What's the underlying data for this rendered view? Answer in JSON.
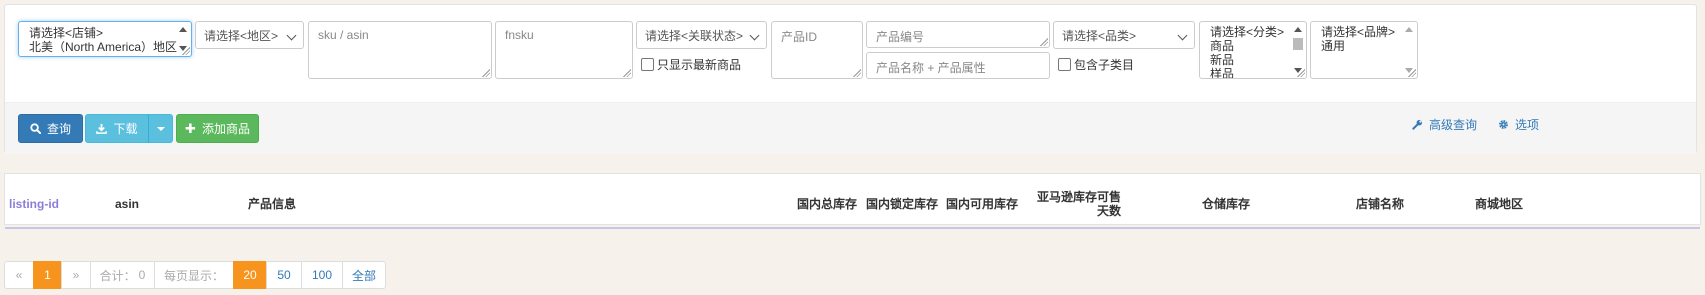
{
  "filters": {
    "shop_select": {
      "placeholder": "请选择<店铺>",
      "selected": "北美（North America）地区"
    },
    "region_select": {
      "value": "请选择<地区>"
    },
    "sku_input": {
      "placeholder": "sku / asin"
    },
    "fnsku_input": {
      "placeholder": "fnsku"
    },
    "link_status_select": {
      "value": "请选择<关联状态>"
    },
    "latest_only": {
      "label": "只显示最新商品"
    },
    "product_id_input": {
      "placeholder": "产品ID"
    },
    "product_code_input": {
      "placeholder": "产品编号"
    },
    "product_name_input": {
      "placeholder": "产品名称 + 产品属性"
    },
    "category_select": {
      "value": "请选择<品类>"
    },
    "include_sub": {
      "label": "包含子类目"
    },
    "class_list": {
      "options": [
        "请选择<分类>",
        "商品",
        "新品",
        "样品"
      ]
    },
    "brand_list": {
      "options": [
        "请选择<品牌>",
        "通用"
      ]
    }
  },
  "toolbar": {
    "query_label": "查询",
    "download_label": "下载",
    "add_label": "添加商品",
    "advanced_label": "高级查询",
    "options_label": "选项"
  },
  "table": {
    "columns": [
      "listing-id",
      "asin",
      "产品信息",
      "国内总库存",
      "国内锁定库存",
      "国内可用库存",
      "亚马逊库存可售天数",
      "仓储库存",
      "店铺名称",
      "商城地区"
    ]
  },
  "pagination": {
    "prev": "«",
    "current": "1",
    "next": "»",
    "total_label": "合计：",
    "total_value": "0",
    "per_page_label": "每页显示：",
    "sizes": [
      "20",
      "50",
      "100",
      "全部"
    ],
    "active_size": "20"
  },
  "colors": {
    "primary": "#337ab7",
    "info": "#5bc0de",
    "success": "#5cb85c",
    "active_page": "#f7941d"
  }
}
